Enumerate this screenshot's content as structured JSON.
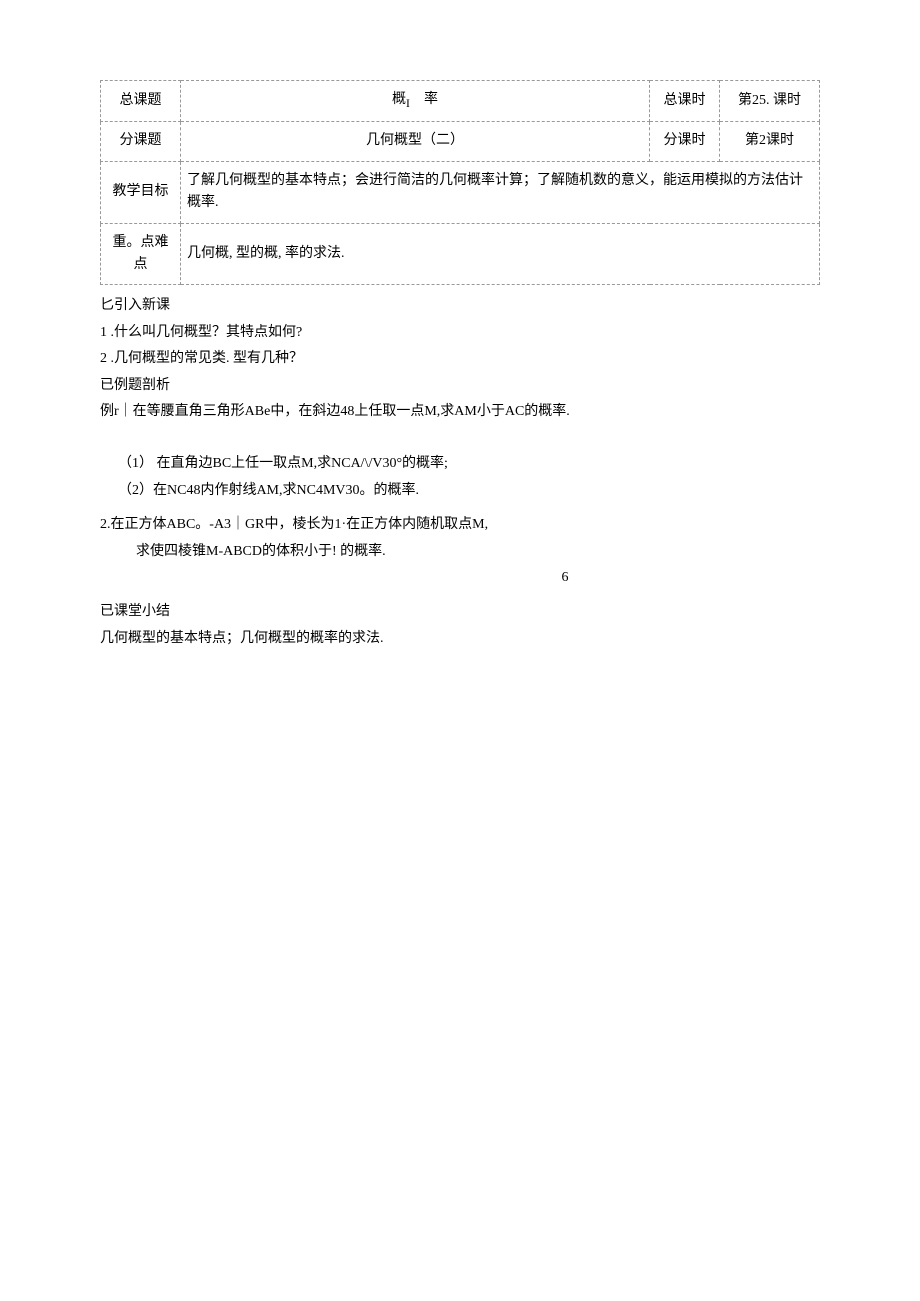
{
  "table": {
    "r1": {
      "label": "总课题",
      "main_a": "概",
      "main_b": "率",
      "c3": "总课时",
      "c4": "第25. 课时"
    },
    "r2": {
      "label": "分课题",
      "main": "几何概型（二）",
      "c3": "分课时",
      "c4": "第2课时"
    },
    "r3": {
      "label": "教学目标",
      "main": "了解几何概型的基本特点；会进行简洁的几何概率计算；了解随机数的意义，能运用模拟的方法估计概率."
    },
    "r4": {
      "label": "重。点难点",
      "main": "几何概, 型的概, 率的求法."
    }
  },
  "body": {
    "s1": "匕引入新课",
    "s2": "1 .什么叫几何概型？其特点如何?",
    "s3": "2  .几何概型的常见类. 型有几种？",
    "s4": "已例题剖析",
    "s5": "例r｜在等腰直角三角形ABe中，在斜边48上任取一点M,求AM小于AC的概率.",
    "s6": "（1） 在直角边BC上任一取点M,求NCA/\\/V30°的概率;",
    "s7": "（2）在NC48内作射线AM,求NC4MV30。的概率.",
    "s8": "2.在正方体ABC。-A3｜GR中，棱长为1·在正方体内随机取点M,",
    "s9": "求使四棱锥M-ABCD的体积小于! 的概率.",
    "s10": "6",
    "s11": "已课堂小结",
    "s12": "几何概型的基本特点；几何概型的概率的求法."
  }
}
